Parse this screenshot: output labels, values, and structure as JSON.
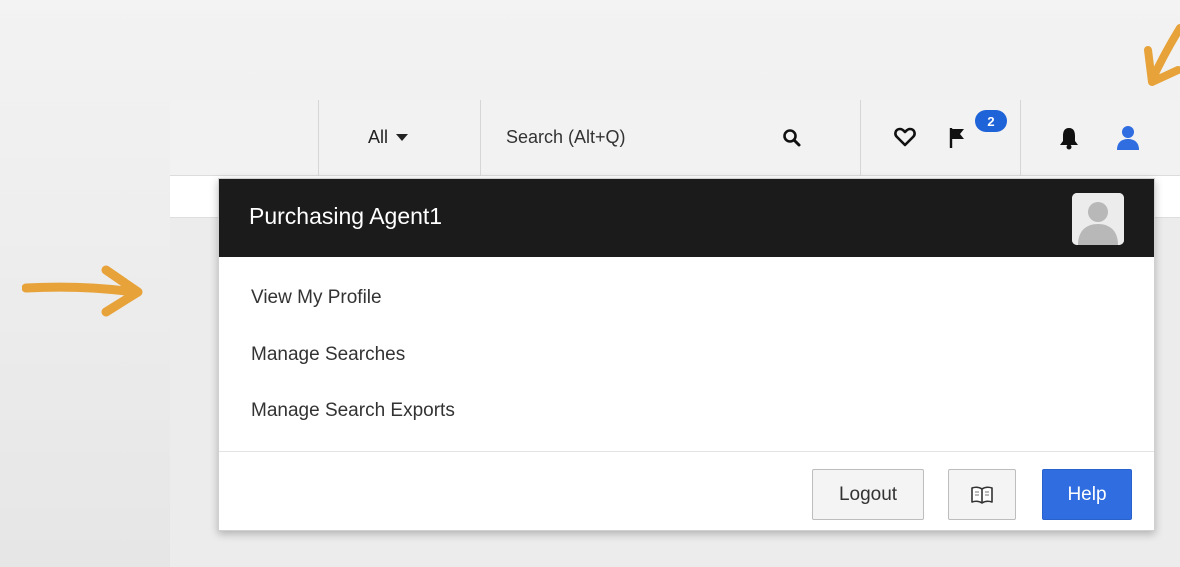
{
  "topbar": {
    "scope_label": "All",
    "search_placeholder": "Search (Alt+Q)",
    "flag_badge_count": "2",
    "icons": [
      "search-icon",
      "heart-icon",
      "flag-icon",
      "bell-icon",
      "user-icon"
    ]
  },
  "user_menu": {
    "user_name": "Purchasing Agent1",
    "items": [
      {
        "label": "View My Profile"
      },
      {
        "label": "Manage Searches"
      },
      {
        "label": "Manage Search Exports"
      }
    ],
    "logout_label": "Logout",
    "help_label": "Help"
  },
  "colors": {
    "accent_blue": "#2f6de0",
    "header_dark": "#1b1b1b",
    "annotation_orange": "#e7a23a"
  }
}
